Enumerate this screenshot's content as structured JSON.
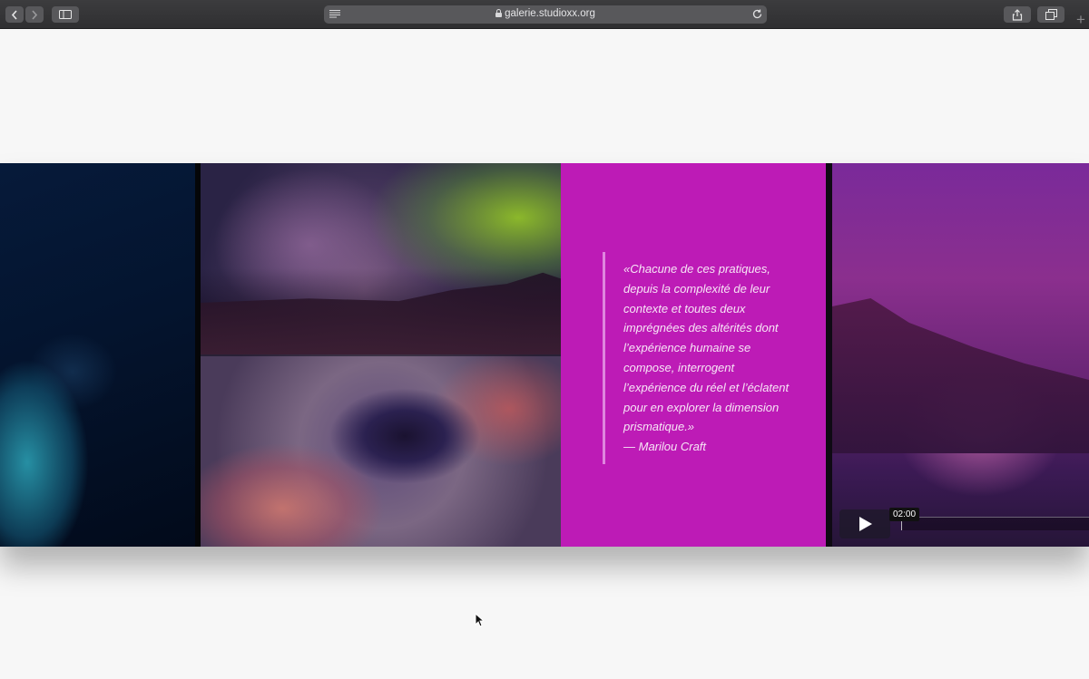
{
  "browser": {
    "url": "galerie.studioxx.org",
    "icons": [
      "back-icon",
      "forward-icon",
      "sidebar-icon",
      "reader-icon",
      "lock-icon",
      "reload-icon",
      "share-icon",
      "tabs-icon",
      "new-tab-icon"
    ],
    "new_tab_label": "+"
  },
  "quote": {
    "lines": [
      "«Chacune de ces pratiques,",
      "depuis la complexité de leur",
      "contexte et toutes deux",
      "imprégnées des altérités dont",
      "l’expérience humaine se",
      "compose, interrogent",
      "l’expérience du réel et l’éclatent",
      "pour en explorer la dimension",
      "prismatique.»",
      "— Marilou Craft"
    ]
  },
  "video": {
    "timecode": "02:00",
    "icons": [
      "play-icon"
    ]
  },
  "colors": {
    "quote_panel": "#bd1bb6",
    "toolbar": "#353537",
    "page_background": "#f7f7f7"
  }
}
